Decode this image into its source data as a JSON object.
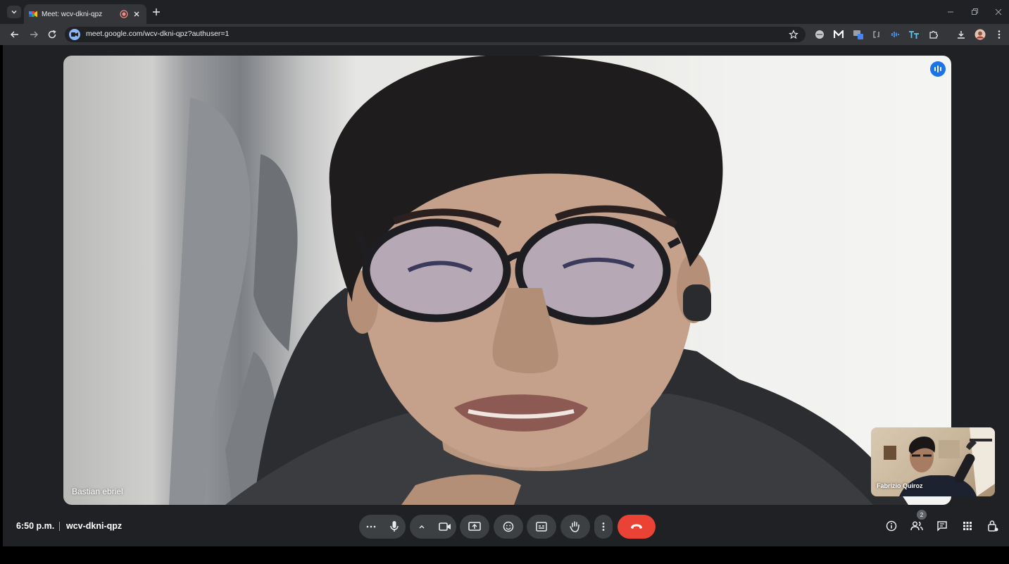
{
  "browser": {
    "tab": {
      "title": "Meet: wcv-dkni-qpz"
    },
    "address_bar": {
      "url": "meet.google.com/wcv-dkni-qpz?authuser=1"
    }
  },
  "meeting": {
    "time": "6:50 p.m.",
    "code": "wcv-dkni-qpz",
    "main_participant": "Bastian ebriel",
    "self_participant": "Fabrizio Quiroz",
    "participant_count": "2"
  },
  "icons": {
    "tabstrip": [
      "tab-search-icon",
      "meet-favicon",
      "recording-icon",
      "close-icon",
      "new-tab-icon",
      "minimize-icon",
      "restore-icon",
      "window-close-icon"
    ],
    "toolbar": [
      "back-icon",
      "forward-icon",
      "reload-icon",
      "bookmark-star-icon",
      "extension-icons",
      "downloads-icon",
      "profile-avatar",
      "menu-icon"
    ],
    "controls": [
      "more-options-icon",
      "microphone-icon",
      "caret-up-icon",
      "camera-icon",
      "present-screen-icon",
      "emoji-icon",
      "captions-icon",
      "raise-hand-icon",
      "more-vert-icon",
      "hang-up-icon"
    ],
    "right": [
      "info-icon",
      "people-icon",
      "chat-icon",
      "activities-icon",
      "host-controls-icon"
    ]
  },
  "colors": {
    "hangup": "#ea4335",
    "speaking": "#1a73e8",
    "bar": "#202124",
    "button": "#3c4043"
  }
}
